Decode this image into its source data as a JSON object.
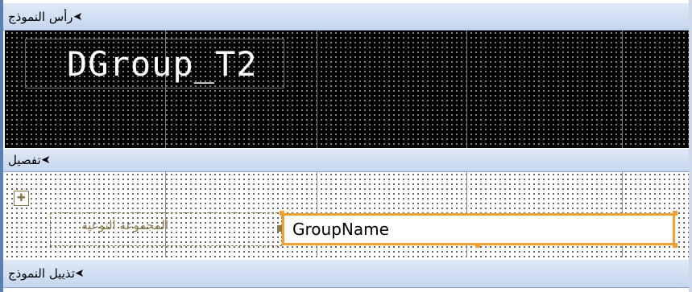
{
  "sections": {
    "form_header": {
      "label": "رأس النموذج"
    },
    "detail": {
      "label": "تفصيل"
    },
    "form_footer": {
      "label": "تذييل النموذج"
    }
  },
  "header_title": "DGroup_T2",
  "detail": {
    "label_text": "المجموعة النوعية",
    "textbox_value": "GroupName"
  },
  "colors": {
    "section_bar": "#c5d6ee",
    "frame_accent": "#5b7fb3",
    "selection": "#f0a030"
  },
  "icons": {
    "section_arrow": "section-arrow-icon",
    "move_handle": "move-handle-icon"
  }
}
